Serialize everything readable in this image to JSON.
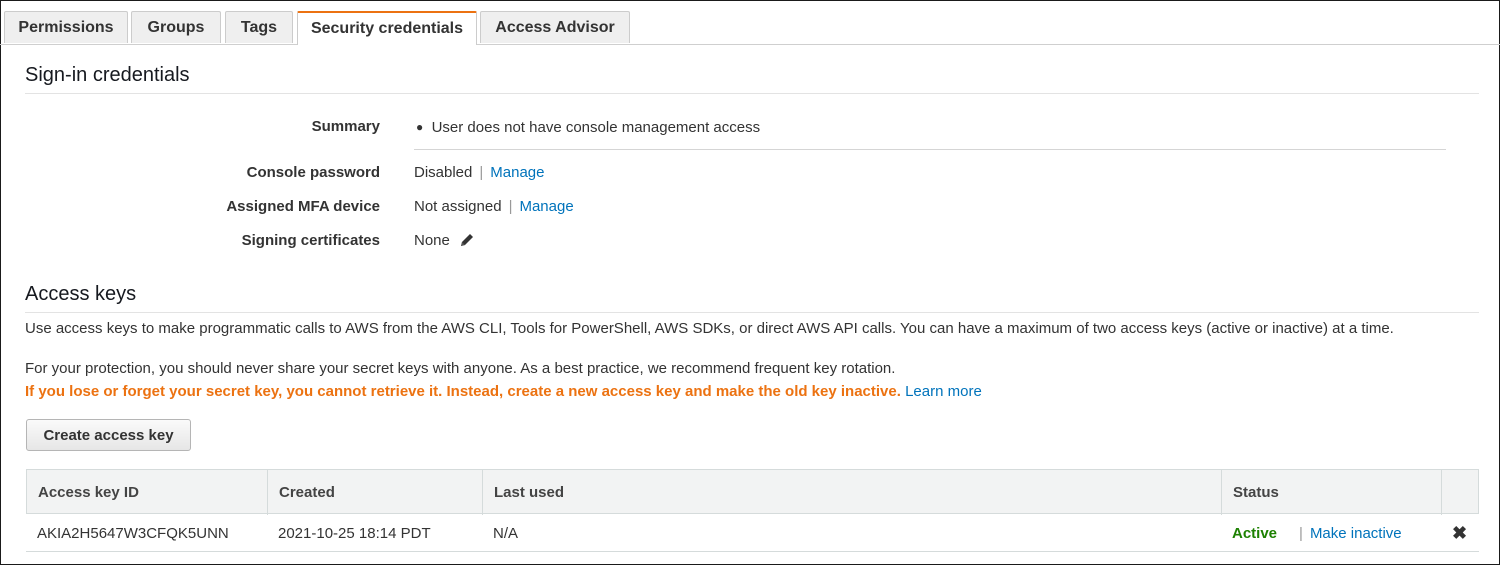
{
  "tabs": [
    {
      "label": "Permissions"
    },
    {
      "label": "Groups"
    },
    {
      "label": "Tags"
    },
    {
      "label": "Security credentials",
      "active": true
    },
    {
      "label": "Access Advisor"
    }
  ],
  "signin": {
    "heading": "Sign-in credentials",
    "summary_label": "Summary",
    "summary_value": "User does not have console management access",
    "console_password_label": "Console password",
    "console_password_value": "Disabled",
    "console_password_action": "Manage",
    "mfa_label": "Assigned MFA device",
    "mfa_value": "Not assigned",
    "mfa_action": "Manage",
    "certs_label": "Signing certificates",
    "certs_value": "None",
    "separator": "|"
  },
  "access_keys": {
    "heading": "Access keys",
    "description": "Use access keys to make programmatic calls to AWS from the AWS CLI, Tools for PowerShell, AWS SDKs, or direct AWS API calls. You can have a maximum of two access keys (active or inactive) at a time.",
    "protection": "For your protection, you should never share your secret keys with anyone. As a best practice, we recommend frequent key rotation.",
    "warning": "If you lose or forget your secret key, you cannot retrieve it. Instead, create a new access key and make the old key inactive.",
    "learn_more": "Learn more",
    "create_button": "Create access key",
    "columns": {
      "key_id": "Access key ID",
      "created": "Created",
      "last_used": "Last used",
      "status": "Status"
    },
    "rows": [
      {
        "key_id": "AKIA2H5647W3CFQK5UNN",
        "created": "2021-10-25 18:14 PDT",
        "last_used": "N/A",
        "status": "Active",
        "action": "Make inactive"
      }
    ]
  },
  "colors": {
    "accent": "#ec7211",
    "link": "#0073bb",
    "active": "#1d8102"
  },
  "icons": {
    "edit": "pencil-icon",
    "delete": "close-icon",
    "bullet": "bullet-icon"
  }
}
